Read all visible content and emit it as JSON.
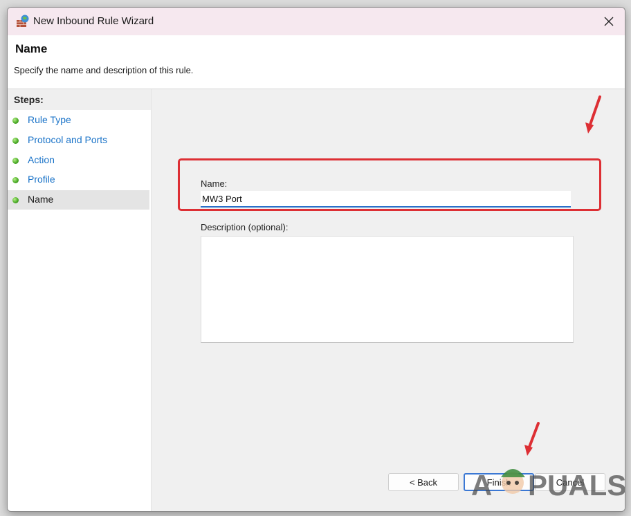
{
  "window": {
    "title": "New Inbound Rule Wizard",
    "close_icon": "close-icon"
  },
  "header": {
    "title": "Name",
    "subtitle": "Specify the name and description of this rule."
  },
  "steps": {
    "heading": "Steps:",
    "items": [
      {
        "label": "Rule Type",
        "active": false
      },
      {
        "label": "Protocol and Ports",
        "active": false
      },
      {
        "label": "Action",
        "active": false
      },
      {
        "label": "Profile",
        "active": false
      },
      {
        "label": "Name",
        "active": true
      }
    ]
  },
  "form": {
    "name_label": "Name:",
    "name_value": "MW3 Port",
    "description_label": "Description (optional):",
    "description_value": ""
  },
  "buttons": {
    "back": "< Back",
    "finish": "Finish",
    "cancel": "Cancel"
  },
  "watermark": {
    "text": "APPUALS"
  },
  "colors": {
    "highlight": "#dd2f34",
    "link": "#1a73c8",
    "step_dot": "#4fae2a",
    "focus": "#2a6fc9"
  }
}
